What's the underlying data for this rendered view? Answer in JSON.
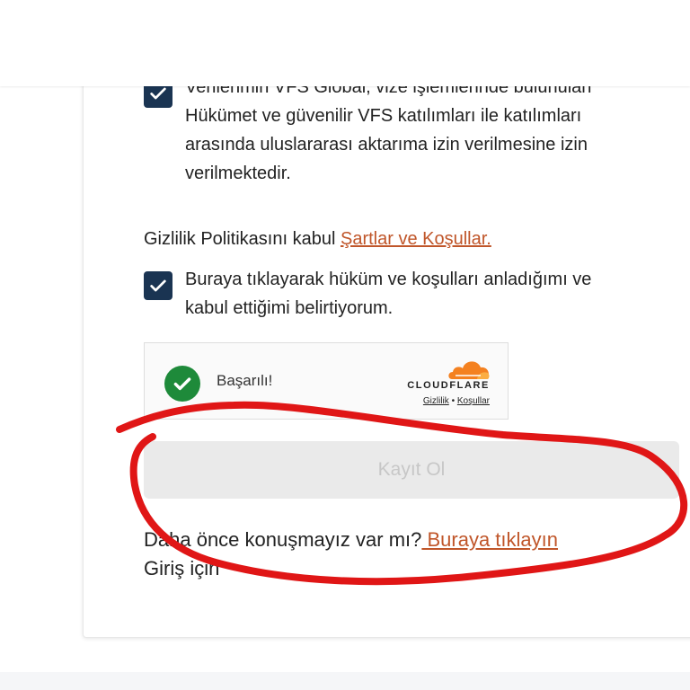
{
  "consent": {
    "first_text_line0": "Verilerimin VFS Global, vize işlemlerinde bulunulan",
    "first_text_line1": "Hükümet ve güvenilir VFS katılımları ile katılımları",
    "first_text_line2": "arasında uluslararası aktarıma izin verilmesine izin",
    "first_text_line3": "verilmektedir.",
    "privacy_prefix": "Gizlilik Politikasını kabul",
    "terms_link": "Şartlar ve Koşullar.",
    "second_text_line1": "Buraya tıklayarak hüküm ve koşulları anladığımı ve",
    "second_text_line2": "kabul ettiğimi belirtiyorum."
  },
  "captcha": {
    "status": "Başarılı!",
    "brand": "CLOUDFLARE",
    "privacy_link": "Gizlilik",
    "separator": "•",
    "terms_link": "Koşullar"
  },
  "form": {
    "submit_label": "Kayıt Ol"
  },
  "login": {
    "prompt": "Daha önce konuşmayız var mı?",
    "link": " Buraya tıklayın",
    "suffix": "Giriş için"
  },
  "colors": {
    "checkbox": "#1a3452",
    "link": "#c0562a",
    "annotation": "#e01616",
    "success": "#1e8a3a",
    "cloudflare_orange": "#f48120"
  },
  "icons": {
    "checkbox_checked": "checkmark-icon",
    "captcha_success": "success-check-icon",
    "cloudflare_logo": "cloud-icon"
  }
}
